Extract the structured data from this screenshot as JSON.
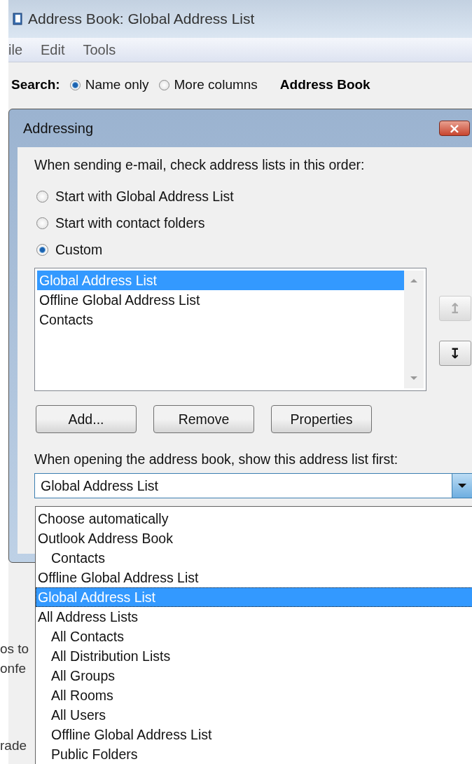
{
  "window": {
    "title": "Address Book: Global Address List"
  },
  "menu": [
    "ile",
    "Edit",
    "Tools"
  ],
  "search": {
    "label": "Search:",
    "options": [
      {
        "label": "Name only",
        "selected": true
      },
      {
        "label": "More columns",
        "selected": false
      }
    ],
    "book_label": "Address Book"
  },
  "background_fragments": [
    "os to",
    "onfe",
    "rade"
  ],
  "dialog": {
    "title": "Addressing",
    "close": "×",
    "order_label": "When sending e-mail, check address lists in this order:",
    "order_options": [
      {
        "label": "Start with Global Address List",
        "selected": false
      },
      {
        "label": "Start with contact folders",
        "selected": false
      },
      {
        "label": "Custom",
        "selected": true
      }
    ],
    "custom_list": [
      {
        "label": "Global Address List",
        "selected": true
      },
      {
        "label": "Offline Global Address List",
        "selected": false
      },
      {
        "label": "Contacts",
        "selected": false
      }
    ],
    "move_buttons": [
      {
        "glyph": "↥",
        "disabled": true
      },
      {
        "glyph": "↧",
        "disabled": false
      }
    ],
    "buttons": [
      "Add...",
      "Remove",
      "Properties"
    ],
    "first_label": "When opening the address book, show this address list first:",
    "first_combo": {
      "value": "Global Address List"
    },
    "dropdown": [
      {
        "label": "Choose automatically",
        "selected": false
      },
      {
        "label": "Outlook Address Book",
        "selected": false,
        "children": [
          {
            "label": "Contacts",
            "selected": false
          }
        ]
      },
      {
        "label": "Offline Global Address List",
        "selected": false
      },
      {
        "label": "Global Address List",
        "selected": true
      },
      {
        "label": "All Address Lists",
        "selected": false,
        "children": [
          {
            "label": "All Contacts",
            "selected": false
          },
          {
            "label": "All Distribution Lists",
            "selected": false
          },
          {
            "label": "All Groups",
            "selected": false
          },
          {
            "label": "All Rooms",
            "selected": false
          },
          {
            "label": "All Users",
            "selected": false
          },
          {
            "label": "Offline Global Address List",
            "selected": false
          },
          {
            "label": "Public Folders",
            "selected": false
          }
        ]
      }
    ]
  }
}
